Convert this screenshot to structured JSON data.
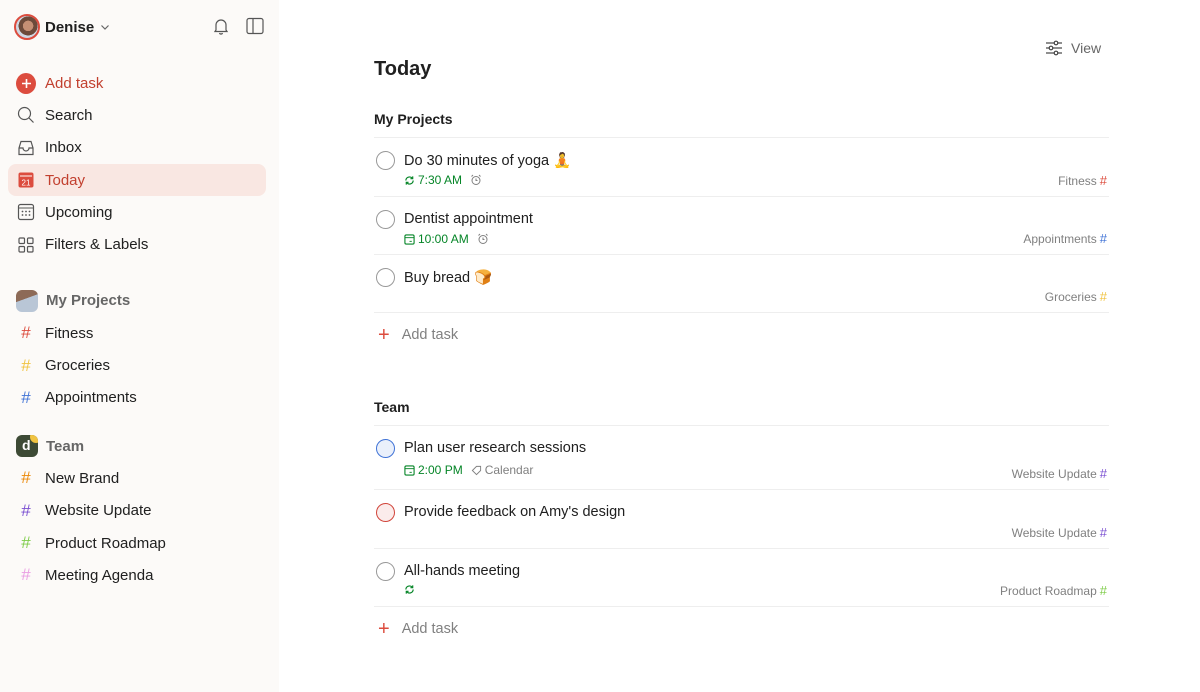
{
  "user": {
    "name": "Denise"
  },
  "sidebar": {
    "nav": [
      {
        "label": "Add task",
        "icon": "add-circle-icon"
      },
      {
        "label": "Search",
        "icon": "search-icon"
      },
      {
        "label": "Inbox",
        "icon": "inbox-icon"
      },
      {
        "label": "Today",
        "icon": "calendar-today-icon",
        "date": "21",
        "active": true
      },
      {
        "label": "Upcoming",
        "icon": "calendar-grid-icon"
      },
      {
        "label": "Filters & Labels",
        "icon": "grid-icon"
      }
    ],
    "my_projects": {
      "title": "My Projects",
      "items": [
        {
          "label": "Fitness",
          "color": "#dc4c3e"
        },
        {
          "label": "Groceries",
          "color": "#f0c341"
        },
        {
          "label": "Appointments",
          "color": "#4073d6"
        }
      ]
    },
    "team": {
      "title": "Team",
      "avatar_letter": "d",
      "items": [
        {
          "label": "New Brand",
          "color": "#eb8909"
        },
        {
          "label": "Website Update",
          "color": "#7a4fd1"
        },
        {
          "label": "Product Roadmap",
          "color": "#7ecc49"
        },
        {
          "label": "Meeting Agenda",
          "color": "#e99ee3"
        }
      ]
    }
  },
  "main": {
    "view_label": "View",
    "title": "Today",
    "groups": [
      {
        "title": "My Projects",
        "tasks": [
          {
            "name": "Do 30 minutes of yoga 🧘",
            "time": "7:30 AM",
            "time_icon": "recurring-icon",
            "reminder": true,
            "project": "Fitness",
            "project_color": "#dc4c3e"
          },
          {
            "name": "Dentist appointment",
            "time": "10:00 AM",
            "time_icon": "calendar-icon",
            "reminder": true,
            "project": "Appointments",
            "project_color": "#4073d6"
          },
          {
            "name": "Buy bread 🍞",
            "project": "Groceries",
            "project_color": "#f0c341"
          }
        ],
        "add_label": "Add task"
      },
      {
        "title": "Team",
        "tasks": [
          {
            "name": "Plan user research sessions",
            "time": "2:00 PM",
            "time_icon": "calendar-icon",
            "label": "Calendar",
            "priority": "blue",
            "project": "Website Update",
            "project_color": "#7a4fd1"
          },
          {
            "name": "Provide feedback on Amy's design",
            "priority": "red",
            "project": "Website Update",
            "project_color": "#7a4fd1"
          },
          {
            "name": "All-hands meeting",
            "time_icon": "recurring-icon",
            "project": "Product Roadmap",
            "project_color": "#7ecc49"
          }
        ],
        "add_label": "Add task"
      }
    ]
  }
}
